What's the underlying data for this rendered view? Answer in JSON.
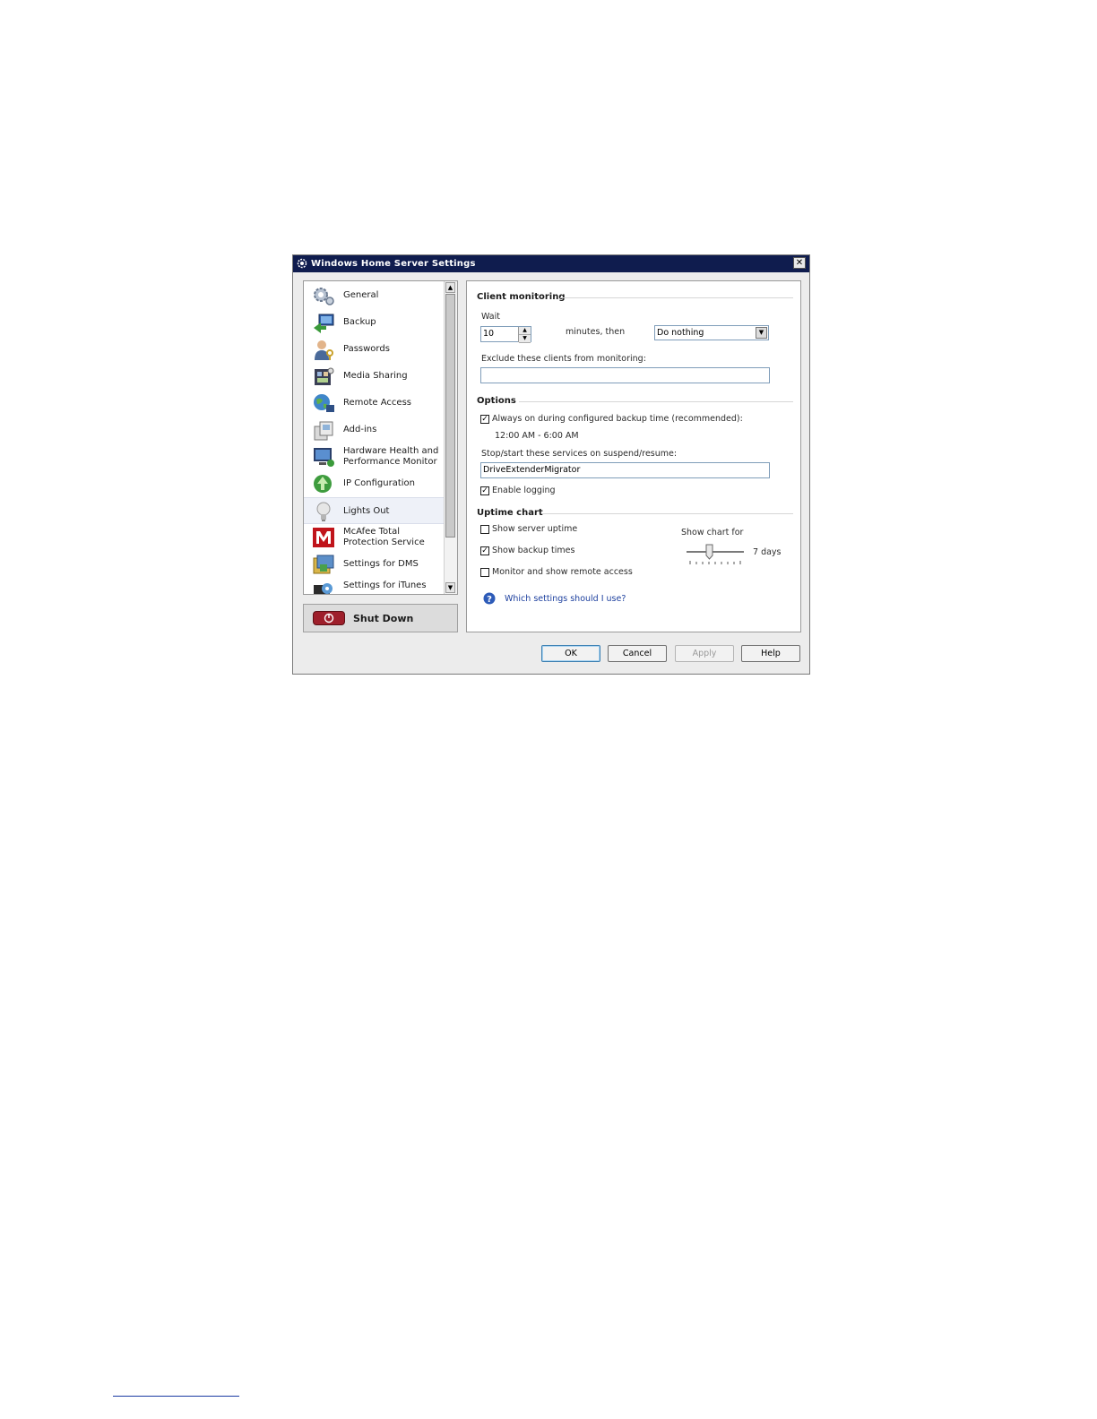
{
  "window": {
    "title": "Windows Home Server Settings",
    "close_label": "✕"
  },
  "nav": {
    "items": [
      {
        "label": "General",
        "icon": "gears-icon"
      },
      {
        "label": "Backup",
        "icon": "backup-computer-icon"
      },
      {
        "label": "Passwords",
        "icon": "user-key-icon"
      },
      {
        "label": "Media Sharing",
        "icon": "media-icon"
      },
      {
        "label": "Remote Access",
        "icon": "globe-computer-icon"
      },
      {
        "label": "Add-ins",
        "icon": "addins-icon"
      },
      {
        "label": "Hardware Health and Performance Monitor",
        "icon": "monitor-icon"
      },
      {
        "label": "IP Configuration",
        "icon": "network-icon"
      },
      {
        "label": "Lights Out",
        "icon": "lightbulb-icon"
      },
      {
        "label": "McAfee Total Protection Service",
        "icon": "mcafee-icon"
      },
      {
        "label": "Settings for DMS",
        "icon": "dms-icon"
      },
      {
        "label": "Settings for iTunes",
        "icon": "itunes-icon"
      }
    ],
    "selected": "Lights Out"
  },
  "shutdown": {
    "label": "Shut Down"
  },
  "client_monitoring": {
    "title": "Client monitoring",
    "wait_label": "Wait",
    "wait_value": "10",
    "minutes_label": "minutes, then",
    "action_value": "Do nothing",
    "exclude_label": "Exclude these clients from monitoring:",
    "exclude_value": ""
  },
  "options": {
    "title": "Options",
    "always_on_label": "Always on during configured backup time (recommended):",
    "always_on_checked": true,
    "time_range": "12:00 AM - 6:00 AM",
    "services_label": "Stop/start these services on suspend/resume:",
    "services_value": "DriveExtenderMigrator",
    "logging_label": "Enable logging",
    "logging_checked": true
  },
  "uptime_chart": {
    "title": "Uptime chart",
    "show_uptime_label": "Show server uptime",
    "show_uptime_checked": false,
    "show_backup_label": "Show backup times",
    "show_backup_checked": true,
    "remote_access_label": "Monitor and show remote access",
    "remote_access_checked": false,
    "show_chart_for_label": "Show chart for",
    "days_value": "7 days"
  },
  "help_link": "Which settings should I use?",
  "buttons": {
    "ok": "OK",
    "cancel": "Cancel",
    "apply": "Apply",
    "help": "Help"
  },
  "colors": {
    "titlebar": "#0f1c4e",
    "link": "#1c3f9e",
    "shutdown": "#9e1f2b"
  }
}
